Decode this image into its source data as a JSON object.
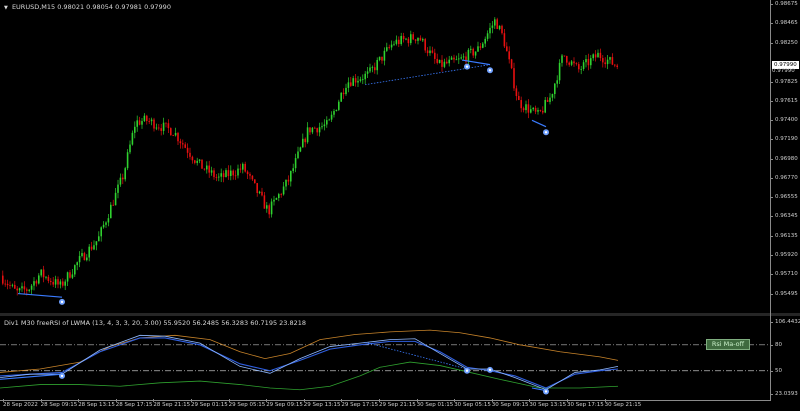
{
  "chart": {
    "symbol": "EURUSD,M15",
    "ohlc": "0.98021 0.98054 0.97981 0.97990",
    "current_price": "0.97990",
    "current_price_2": "0.97990"
  },
  "price_axis": [
    {
      "label": "0.98675",
      "value": 0.98675
    },
    {
      "label": "0.98465",
      "value": 0.98465
    },
    {
      "label": "0.98250",
      "value": 0.9825
    },
    {
      "label": "0.97825",
      "value": 0.97825
    },
    {
      "label": "0.97615",
      "value": 0.97615
    },
    {
      "label": "0.97400",
      "value": 0.974
    },
    {
      "label": "0.97190",
      "value": 0.9719
    },
    {
      "label": "0.96980",
      "value": 0.9698
    },
    {
      "label": "0.96770",
      "value": 0.9677
    },
    {
      "label": "0.96555",
      "value": 0.96555
    },
    {
      "label": "0.96345",
      "value": 0.96345
    },
    {
      "label": "0.96135",
      "value": 0.96135
    },
    {
      "label": "0.95920",
      "value": 0.9592
    },
    {
      "label": "0.95710",
      "value": 0.9571
    },
    {
      "label": "0.95495",
      "value": 0.95495
    }
  ],
  "oscillator": {
    "title": "Div1 M30 freeRSI of LWMA (13, 4, 3, 3, 20, 3.00) 55.9520 56.2485 56.3283 60.7195 23.8218",
    "badge": "Rsi Ma-off",
    "axis": [
      {
        "label": "106.4432",
        "value": 106.4432
      },
      {
        "label": "80",
        "value": 80
      },
      {
        "label": "50",
        "value": 50
      },
      {
        "label": "23.0393",
        "value": 23.0393
      }
    ]
  },
  "time_axis": [
    "28 Sep 2022",
    "28 Sep 09:15",
    "28 Sep 13:15",
    "28 Sep 17:15",
    "28 Sep 21:15",
    "29 Sep 01:15",
    "29 Sep 05:15",
    "29 Sep 09:15",
    "29 Sep 13:15",
    "29 Sep 17:15",
    "29 Sep 21:15",
    "30 Sep 01:15",
    "30 Sep 05:15",
    "30 Sep 09:15",
    "30 Sep 13:15",
    "30 Sep 17:15",
    "30 Sep 21:15"
  ],
  "colors": {
    "bull": "#2fd12f",
    "bear": "#e81010",
    "divergence": "#3a7bff",
    "rsi_fast": "#8fb8ff",
    "rsi_slow": "#2f5fe0",
    "band_upper": "#c8842a",
    "band_lower": "#2fa12f",
    "level": "#bdbdbd"
  }
}
